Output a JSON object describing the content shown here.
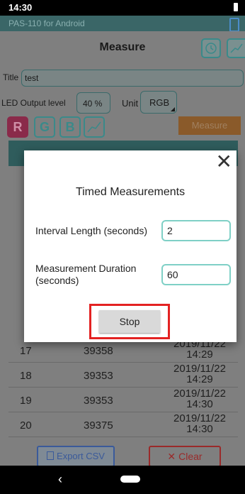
{
  "status": {
    "time": "14:30"
  },
  "app": {
    "name": "PAS-110 for Android"
  },
  "header": {
    "title": "Measure"
  },
  "form": {
    "title_label": "Title",
    "title_value": "test",
    "led_label": "LED Output level",
    "led_value": "40 %",
    "unit_label": "Unit",
    "unit_value": "RGB"
  },
  "channels": {
    "r": "R",
    "g": "G",
    "b": "B"
  },
  "measure_button": "Measure",
  "rows": [
    {
      "n": "17",
      "v": "39358",
      "d": "2019/11/22",
      "t": "14:29"
    },
    {
      "n": "18",
      "v": "39353",
      "d": "2019/11/22",
      "t": "14:29"
    },
    {
      "n": "19",
      "v": "39353",
      "d": "2019/11/22",
      "t": "14:30"
    },
    {
      "n": "20",
      "v": "39375",
      "d": "2019/11/22",
      "t": "14:30"
    }
  ],
  "bottom": {
    "export": "Export CSV",
    "clear": "Clear"
  },
  "dialog": {
    "title": "Timed Measurements",
    "interval_label": "Interval Length (seconds)",
    "interval_value": "2",
    "duration_label": "Measurement Duration (seconds)",
    "duration_value": "60",
    "stop": "Stop"
  },
  "colors": {
    "accent": "#7fd0c6",
    "highlight": "#e32222",
    "r_channel": "#c0306a"
  }
}
